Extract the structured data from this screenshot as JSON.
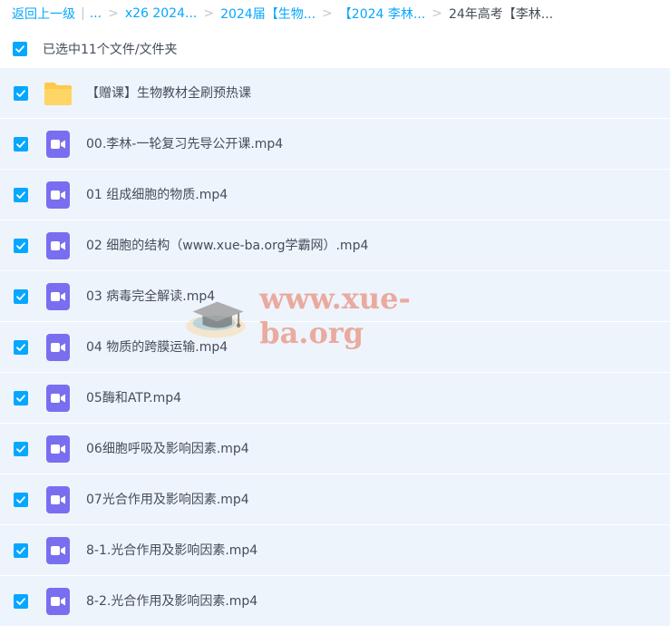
{
  "breadcrumb": {
    "back": "返回上一级",
    "root": "...",
    "items": [
      "x26 2024...",
      "2024届【生物...",
      "【2024 李林...",
      "24年高考【李林..."
    ]
  },
  "selection": {
    "label": "已选中11个文件/文件夹",
    "checked": true
  },
  "files": [
    {
      "name": "【赠课】生物教材全刷预热课",
      "type": "folder",
      "checked": true
    },
    {
      "name": "00.李林-一轮复习先导公开课.mp4",
      "type": "video",
      "checked": true
    },
    {
      "name": "01 组成细胞的物质.mp4",
      "type": "video",
      "checked": true
    },
    {
      "name": "02 细胞的结构（www.xue-ba.org学霸网）.mp4",
      "type": "video",
      "checked": true
    },
    {
      "name": "03 病毒完全解读.mp4",
      "type": "video",
      "checked": true
    },
    {
      "name": "04 物质的跨膜运输.mp4",
      "type": "video",
      "checked": true
    },
    {
      "name": "05酶和ATP.mp4",
      "type": "video",
      "checked": true
    },
    {
      "name": "06细胞呼吸及影响因素.mp4",
      "type": "video",
      "checked": true
    },
    {
      "name": "07光合作用及影响因素.mp4",
      "type": "video",
      "checked": true
    },
    {
      "name": "8-1.光合作用及影响因素.mp4",
      "type": "video",
      "checked": true
    },
    {
      "name": "8-2.光合作用及影响因素.mp4",
      "type": "video",
      "checked": true
    }
  ],
  "watermark": {
    "text": "www.xue-ba.org"
  },
  "colors": {
    "accent": "#06a7ff",
    "row_bg": "#eef4fc",
    "video_icon": "#7a6ef0",
    "folder_icon": "#ffc94a"
  }
}
